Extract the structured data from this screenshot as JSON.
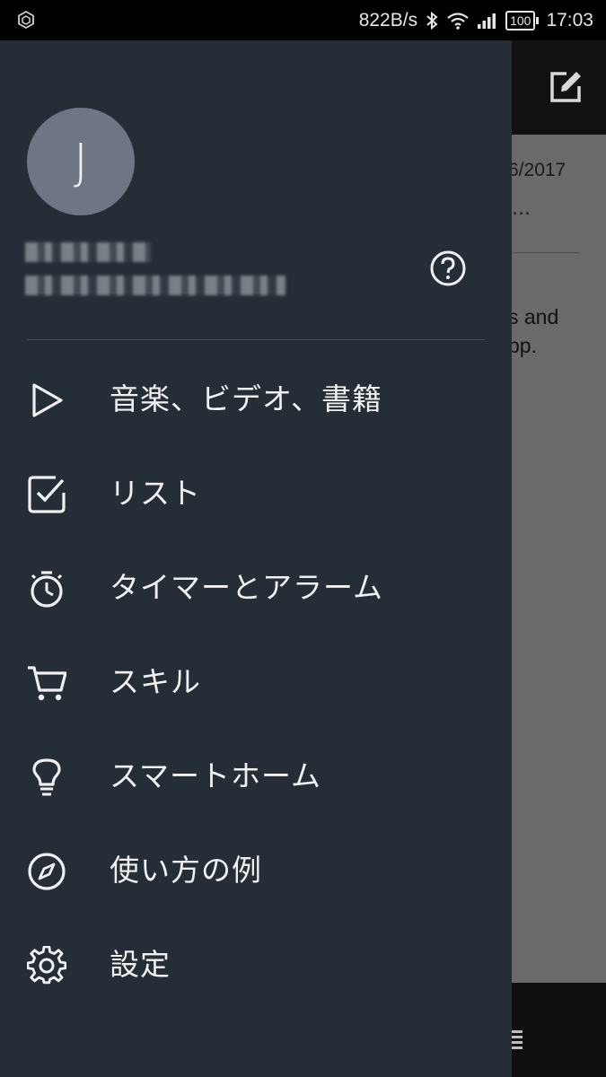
{
  "status_bar": {
    "net_speed": "822B/s",
    "battery_level": "100",
    "time": "17:03"
  },
  "background_app": {
    "date_fragment": "6/2017",
    "ellipsis": "…",
    "text_line1": "s and",
    "text_line2": "pp."
  },
  "drawer": {
    "avatar_initial": "J",
    "user_name": "",
    "user_email": "",
    "menu": [
      {
        "label": "音楽、ビデオ、書籍",
        "icon": "play-icon"
      },
      {
        "label": "リスト",
        "icon": "checkbox-icon"
      },
      {
        "label": "タイマーとアラーム",
        "icon": "stopwatch-icon"
      },
      {
        "label": "スキル",
        "icon": "cart-icon"
      },
      {
        "label": "スマートホーム",
        "icon": "lightbulb-icon"
      },
      {
        "label": "使い方の例",
        "icon": "compass-icon"
      },
      {
        "label": "設定",
        "icon": "gear-icon"
      }
    ]
  },
  "colors": {
    "drawer_bg": "#252d36",
    "avatar_bg": "#6d7682",
    "text": "#f0f0f0"
  }
}
